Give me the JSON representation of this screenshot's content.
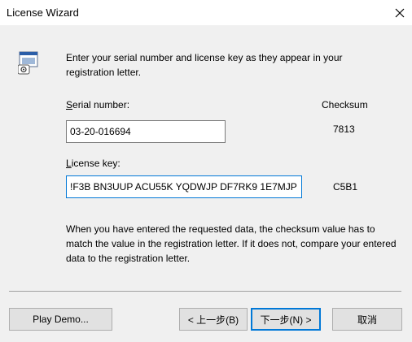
{
  "window": {
    "title": "License Wizard",
    "close_glyph": "✕"
  },
  "intro_text": "Enter your serial number and license key as they appear in your registration letter.",
  "serial": {
    "label_prefix": "",
    "label_mnemonic": "S",
    "label_rest": "erial number:",
    "value": "03-20-016694",
    "checksum": "7813"
  },
  "license": {
    "label_prefix": "",
    "label_mnemonic": "L",
    "label_rest": "icense key:",
    "value": "!F3B BN3UUP ACU55K YQDWJP DF7RK9 1E7MJP",
    "checksum": "C5B1"
  },
  "checksum_header": "Checksum",
  "note_text": "When you have entered the requested data, the checksum value has to match the value in the registration letter.  If it does not, compare your entered data to the registration letter.",
  "buttons": {
    "play_demo": "Play Demo...",
    "back": "< 上一步(B)",
    "next": "下一步(N) >",
    "cancel": "取消"
  },
  "icons": {
    "app": "license-wizard-icon",
    "close": "close-icon"
  },
  "colors": {
    "focus_border": "#0078d7",
    "window_bg": "#f0f0f0"
  }
}
